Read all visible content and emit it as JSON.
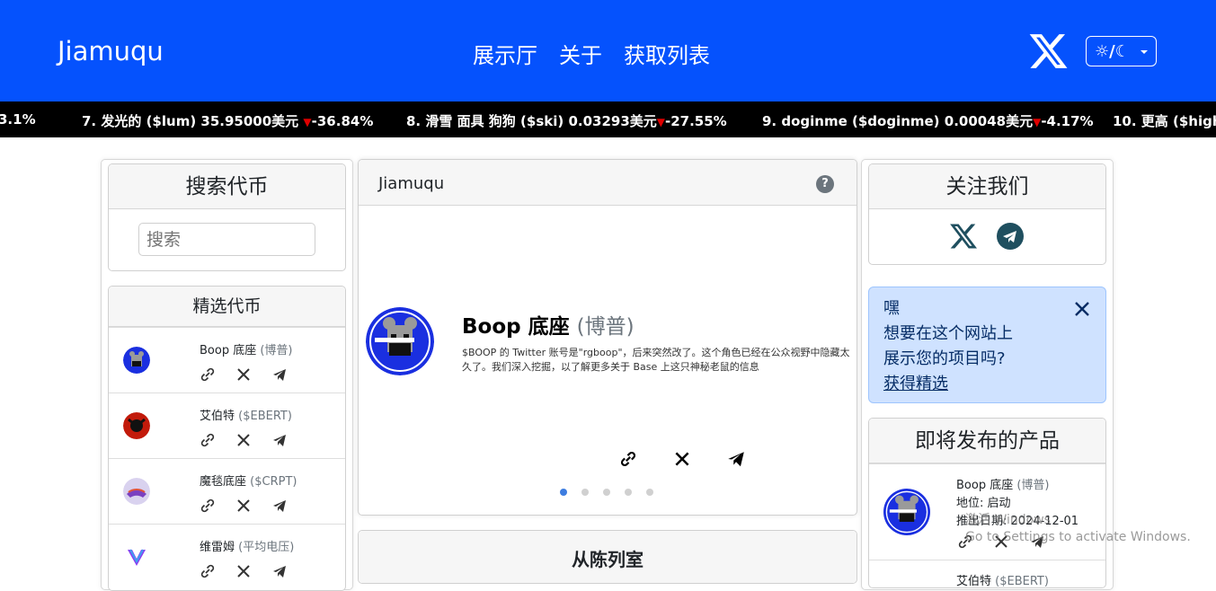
{
  "header": {
    "brand": "Jiamuqu",
    "nav": [
      "展示厅",
      "关于",
      "获取列表"
    ],
    "theme_label": "☼/☾"
  },
  "ticker": [
    {
      "text": "3.1%",
      "change": ""
    },
    {
      "text": "7. 发光的 ($lum) 35.95000美元",
      "change": "-36.84%"
    },
    {
      "text": "8. 滑雪 面具 狗狗 ($ski) 0.03293美元",
      "change": "-27.55%"
    },
    {
      "text": "9. doginme ($doginme) 0.00048美元",
      "change": "-4.17%"
    },
    {
      "text": "10. 更高 ($highe",
      "change": ""
    }
  ],
  "search": {
    "title": "搜索代币",
    "placeholder": "搜索"
  },
  "featured": {
    "title": "精选代币",
    "coins": [
      {
        "name": "Boop 底座",
        "symbol": "(博普)"
      },
      {
        "name": "艾伯特",
        "symbol": "($EBERT)"
      },
      {
        "name": "魔毯底座",
        "symbol": "($CRPT)"
      },
      {
        "name": "维雷姆",
        "symbol": "(平均电压)"
      }
    ]
  },
  "carousel": {
    "header": "Jiamuqu",
    "help": "?",
    "name": "Boop 底座",
    "symbol": "(博普)",
    "description": "$BOOP 的 Twitter 账号是\"rgboop\"，后来突然改了。这个角色已经在公众视野中隐藏太久了。我们深入挖掘，以了解更多关于 Base 上这只神秘老鼠的信息"
  },
  "showroom": {
    "title": "从陈列室"
  },
  "follow": {
    "title": "关注我们"
  },
  "promo": {
    "lines": [
      "嘿",
      "想要在这个网站上",
      "展示您的项目吗?"
    ],
    "link": "获得精选"
  },
  "upcoming": {
    "title": "即将发布的产品",
    "items": [
      {
        "name": "Boop 底座",
        "symbol": "(博普)",
        "status": "地位: 启动",
        "date": "推出日期: 2024-12-01"
      },
      {
        "name": "艾伯特",
        "symbol": "($EBERT)"
      }
    ]
  },
  "watermark": {
    "line1": "激活 Windows",
    "line2": "Go to Settings to activate Windows."
  },
  "colors": {
    "primary": "#0552fd",
    "ticker_bg": "#000000",
    "down": "#e00000",
    "alert_bg": "#cfe2ff"
  }
}
